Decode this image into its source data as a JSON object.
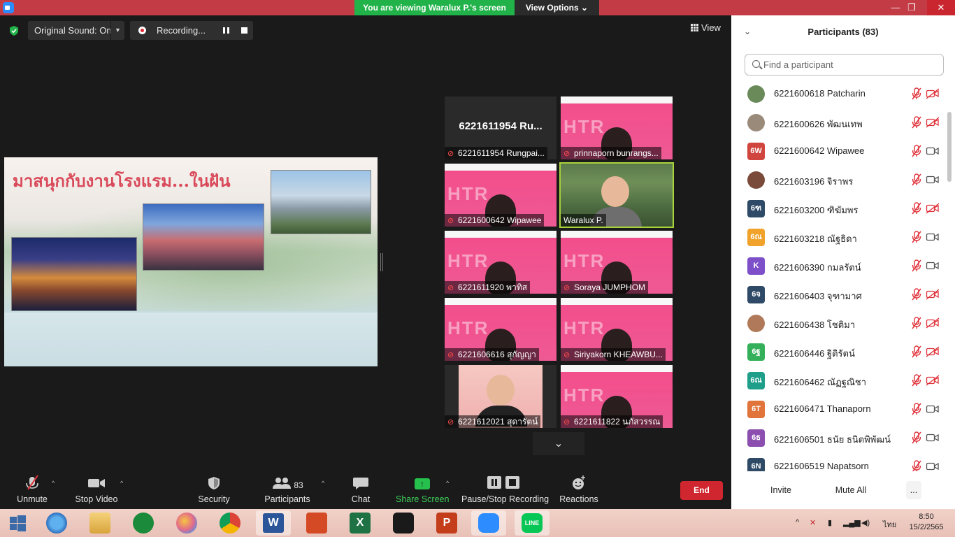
{
  "title_bar": {
    "viewing_banner": "You are viewing Waralux P.'s screen",
    "view_options": "View Options",
    "minimize": "—",
    "restore": "❐",
    "close": "✕"
  },
  "stage_controls": {
    "original_sound": "Original Sound: On",
    "recording": "Recording...",
    "view": "View"
  },
  "shared_slide": {
    "title": "มาสนุกกับงานโรงแรม...ในฝัน"
  },
  "video_tiles": [
    {
      "name": "6221611954 Rungpai...",
      "big_name": "6221611954 Ru...",
      "type": "no-video"
    },
    {
      "name": "prinnaporn bunrangs...",
      "type": "pink"
    },
    {
      "name": "6221600642 Wipawee",
      "type": "pink"
    },
    {
      "name": "Waralux P.",
      "type": "speaker"
    },
    {
      "name": "6221611920 พาทิส",
      "type": "pink"
    },
    {
      "name": "Soraya JUMPHOM",
      "type": "pink"
    },
    {
      "name": "6221606616 สุกัญญา",
      "type": "pink"
    },
    {
      "name": "Siriyakorn KHEAWBU...",
      "type": "pink"
    },
    {
      "name": "6221612021 สุดารัตน์",
      "type": "photo"
    },
    {
      "name": "6221611822 นภัสวรรณ",
      "type": "pink"
    }
  ],
  "tile_watermark": "HTR",
  "toolbar": {
    "unmute": "Unmute",
    "stop_video": "Stop Video",
    "security": "Security",
    "participants": "Participants",
    "participants_count": "83",
    "chat": "Chat",
    "share_screen": "Share Screen",
    "pause_stop_recording": "Pause/Stop Recording",
    "reactions": "Reactions",
    "end": "End"
  },
  "participants_panel": {
    "title": "Participants (83)",
    "search_placeholder": "Find a participant",
    "participants": [
      {
        "name": "6221600618 Patcharin",
        "avatar": "",
        "avatar_color": "#6a8a5a",
        "video_off": true
      },
      {
        "name": "6221600626 พัฒนเทพ",
        "avatar": "",
        "avatar_color": "#9a8a7a",
        "video_off": true
      },
      {
        "name": "6221600642 Wipawee",
        "avatar": "6W",
        "avatar_color": "#d0453e",
        "video_off": false
      },
      {
        "name": "6221603196 จิราพร",
        "avatar": "",
        "avatar_color": "#7a4a3a",
        "video_off": false
      },
      {
        "name": "6221603200 ฑิฆัมพร",
        "avatar": "6ฑ",
        "avatar_color": "#2e4a66",
        "video_off": true
      },
      {
        "name": "6221603218 ณัฐธิดา",
        "avatar": "6ณ",
        "avatar_color": "#f0a22a",
        "video_off": false
      },
      {
        "name": "6221606390 กมลรัตน์",
        "avatar": "K",
        "avatar_color": "#7d4fc9",
        "video_off": false
      },
      {
        "name": "6221606403 จุฑามาศ",
        "avatar": "6จ",
        "avatar_color": "#2e4a66",
        "video_off": true
      },
      {
        "name": "6221606438 โชติมา",
        "avatar": "",
        "avatar_color": "#b07a5a",
        "video_off": true
      },
      {
        "name": "6221606446 ฐิติรัตน์",
        "avatar": "6ฐ",
        "avatar_color": "#34b05a",
        "video_off": true
      },
      {
        "name": "6221606462 ณัฏฐณิชา",
        "avatar": "6ณ",
        "avatar_color": "#1f9e8a",
        "video_off": true
      },
      {
        "name": "6221606471 Thanaporn",
        "avatar": "6T",
        "avatar_color": "#e0743a",
        "video_off": false
      },
      {
        "name": "6221606501 ธนัย ธนิตพิพัฒน์",
        "avatar": "6ธ",
        "avatar_color": "#8c4fb0",
        "video_off": false
      },
      {
        "name": "6221606519 Napatsorn",
        "avatar": "6N",
        "avatar_color": "#2e4a66",
        "video_off": false
      }
    ],
    "invite": "Invite",
    "mute_all": "Mute All",
    "more": "..."
  },
  "taskbar": {
    "language": "ไทย",
    "time": "8:50",
    "date": "15/2/2565"
  }
}
